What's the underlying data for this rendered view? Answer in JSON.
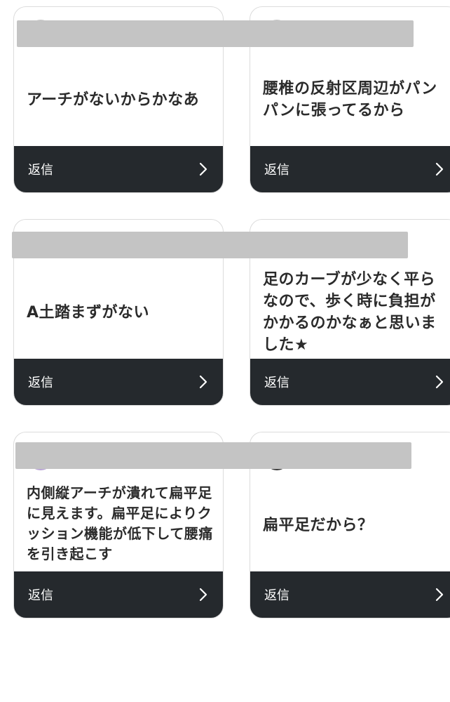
{
  "reply_label": "返信",
  "cards": [
    {
      "text": "アーチがないからかなあ"
    },
    {
      "text": "腰椎の反射区周辺がパンパンに張ってるから"
    },
    {
      "text": "A土踏まずがない"
    },
    {
      "text": "足のカーブが少なく平らなので、歩く時に負担がかかるのかなぁと思いました★"
    },
    {
      "text": "内側縦アーチが潰れて扁平足に見えます。扁平足によりクッション機能が低下して腰痛を引き起こす"
    },
    {
      "text": "扁平足だから？"
    }
  ],
  "colors": {
    "reply_bar": "#25292d",
    "card_border": "#dcdcdc",
    "text": "#2b2b2b",
    "redaction": "#c4c4c4"
  }
}
